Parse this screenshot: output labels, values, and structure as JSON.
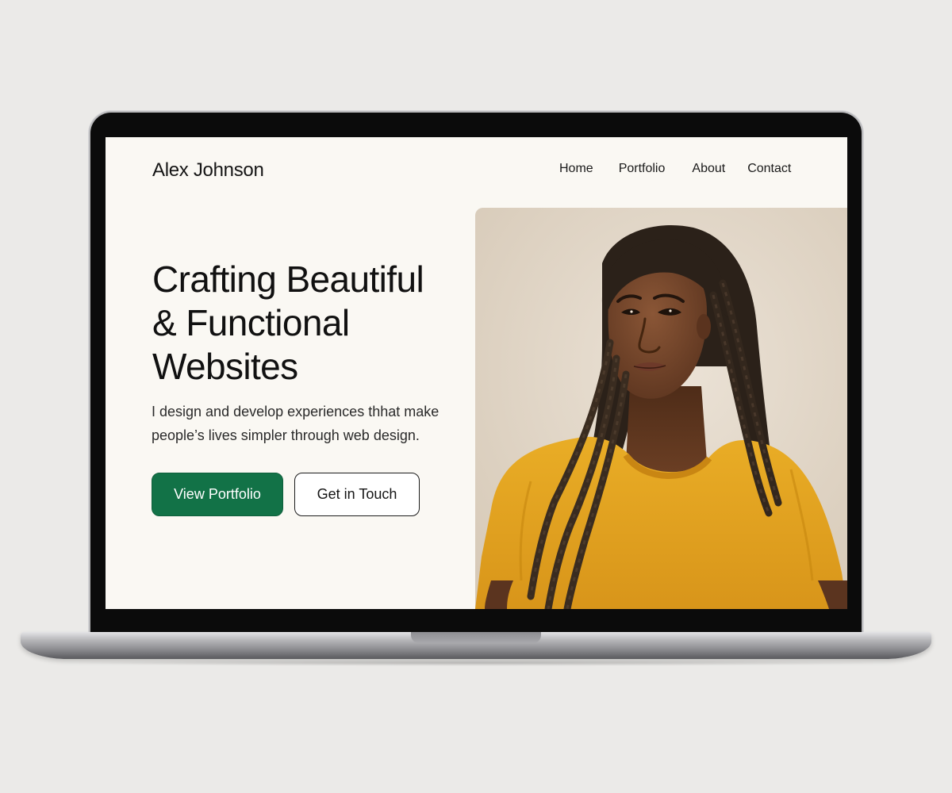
{
  "site": {
    "brand": "Alex Johnson",
    "nav": {
      "home": "Home",
      "portfolio": "Portfolio",
      "about": "About",
      "contact": "Contact"
    }
  },
  "hero": {
    "headline_lines": [
      "Crafting Beautiful",
      "& Functional",
      "Websites"
    ],
    "tagline_lines": [
      "I design and develop experiences thhat make",
      "people’s lives simpler through web design."
    ],
    "primary_button": "View Portfolio",
    "secondary_button": "Get in Touch"
  },
  "colors": {
    "page_background": "#faf8f3",
    "accent_green": "#127247",
    "photo_backdrop": "#e2d7c8",
    "shirt_yellow": "#e3a51f"
  }
}
